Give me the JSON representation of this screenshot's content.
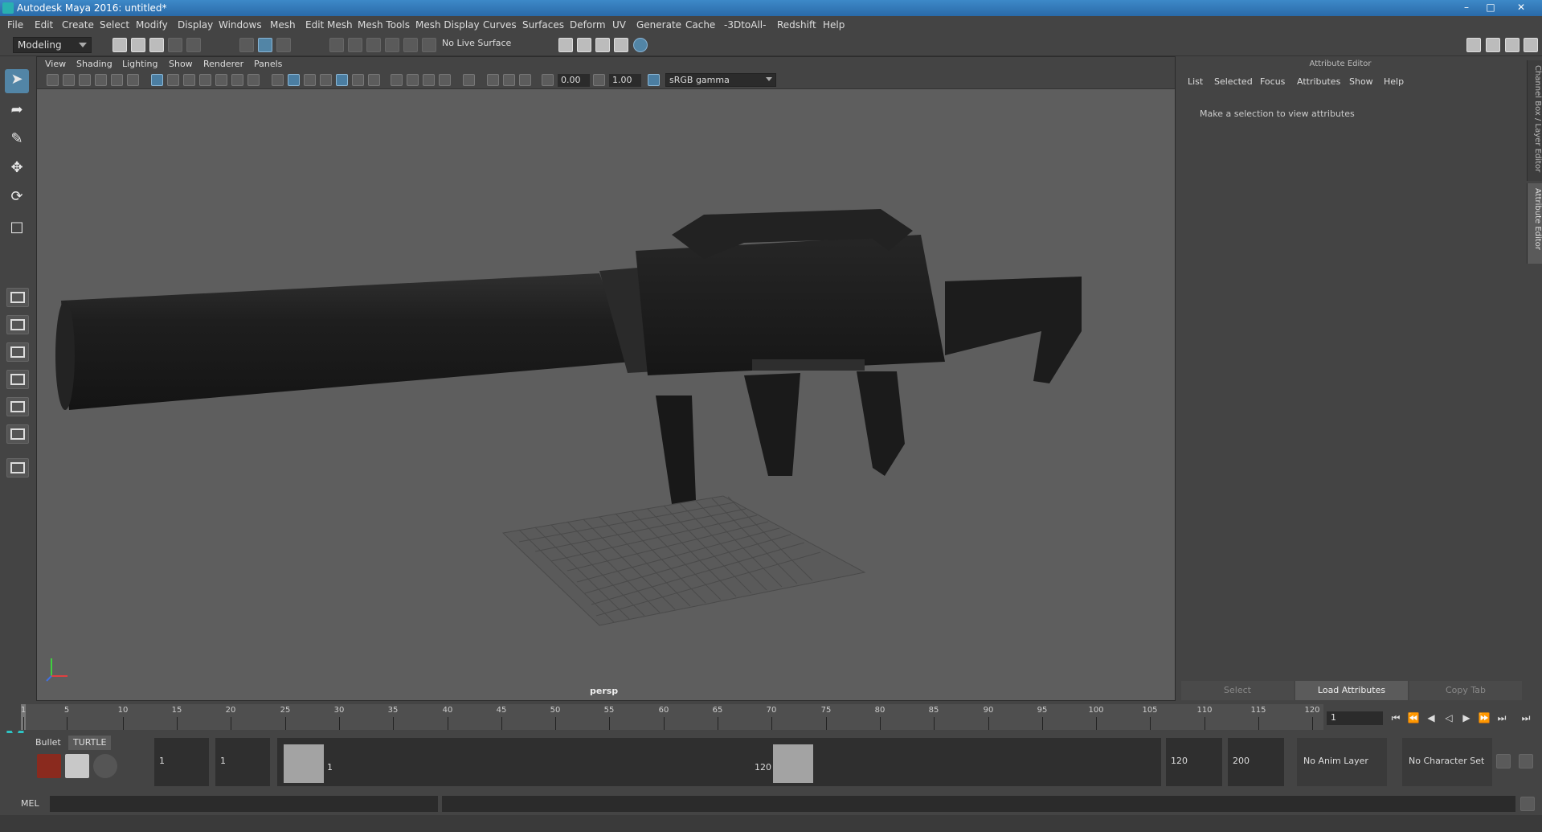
{
  "window": {
    "title": "Autodesk Maya 2016: untitled*"
  },
  "menubar": [
    "File",
    "Edit",
    "Create",
    "Select",
    "Modify",
    "Display",
    "Windows",
    "Mesh",
    "Edit Mesh",
    "Mesh Tools",
    "Mesh Display",
    "Curves",
    "Surfaces",
    "Deform",
    "UV",
    "Generate",
    "Cache",
    "-3DtoAll-",
    "Redshift",
    "Help"
  ],
  "shelf": {
    "mode": "Modeling",
    "live_surface": "No Live Surface"
  },
  "viewport": {
    "menu": [
      "View",
      "Shading",
      "Lighting",
      "Show",
      "Renderer",
      "Panels"
    ],
    "exposure": "0.00",
    "gamma": "1.00",
    "color_space": "sRGB gamma",
    "camera": "persp"
  },
  "attribute_editor": {
    "title": "Attribute Editor",
    "menu": [
      "List",
      "Selected",
      "Focus",
      "Attributes",
      "Show",
      "Help"
    ],
    "message": "Make a selection to view attributes",
    "buttons": {
      "select": "Select",
      "load": "Load Attributes",
      "copy": "Copy Tab"
    },
    "side_tabs": [
      "Channel Box / Layer Editor",
      "Attribute Editor"
    ]
  },
  "timeline": {
    "labels": [
      "1",
      "5",
      "10",
      "15",
      "20",
      "25",
      "30",
      "35",
      "40",
      "45",
      "50",
      "55",
      "60",
      "65",
      "70",
      "75",
      "80",
      "85",
      "90",
      "95",
      "100",
      "105",
      "110",
      "115",
      "120"
    ],
    "current_frame": "1"
  },
  "range": {
    "shelf_tabs": [
      "Bullet",
      "TURTLE"
    ],
    "start_outer": "1",
    "start_inner": "1",
    "slider_start": "1",
    "slider_end": "120",
    "end_inner": "120",
    "end_outer": "200",
    "anim_layer": "No Anim Layer",
    "character_set": "No Character Set"
  },
  "cmdline": {
    "label": "MEL"
  }
}
